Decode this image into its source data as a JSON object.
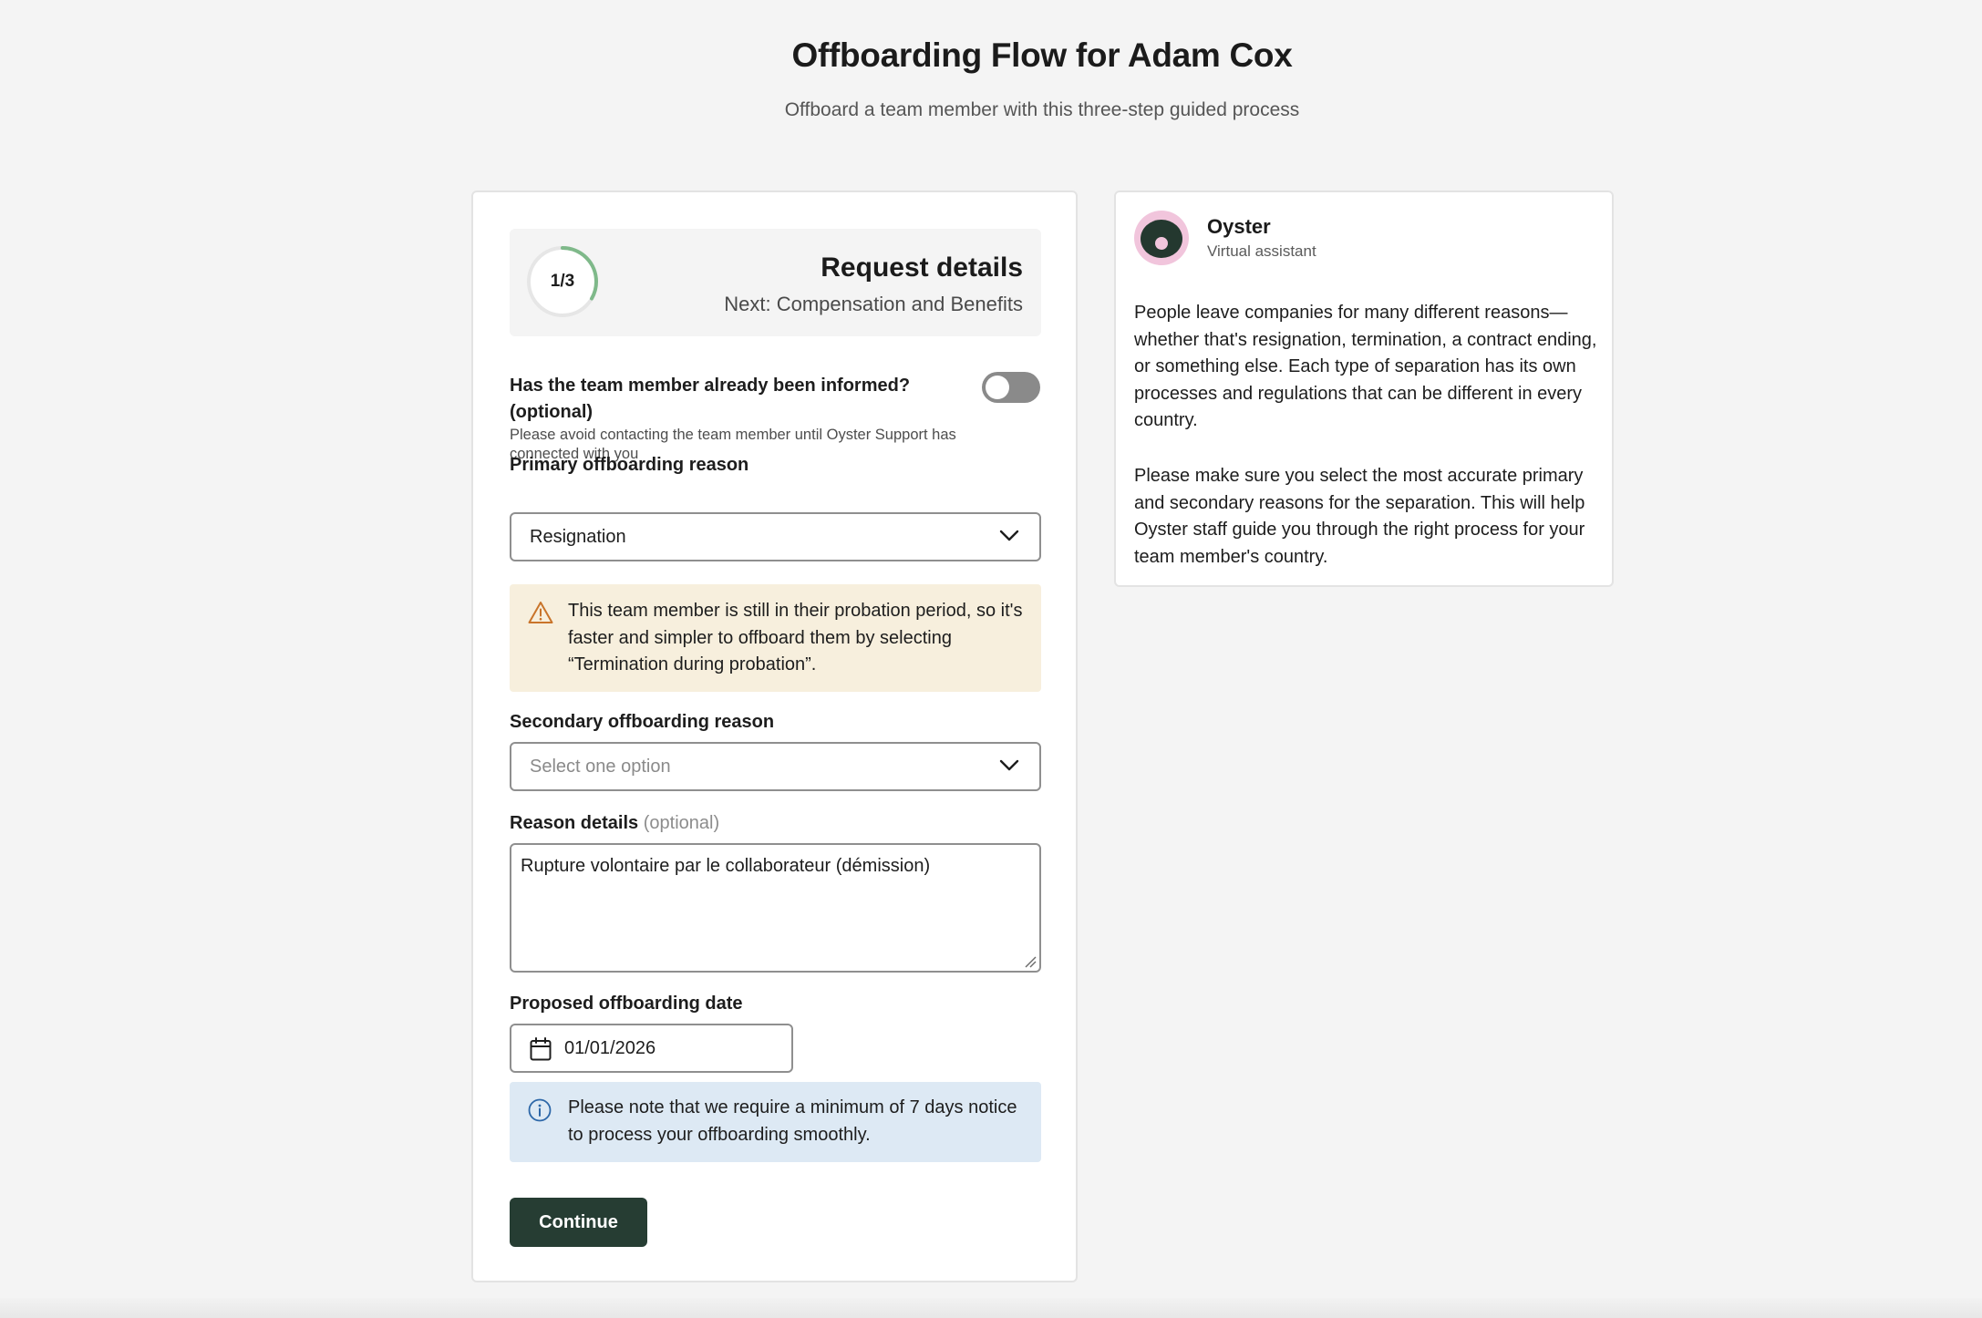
{
  "page": {
    "title": "Offboarding Flow for Adam Cox",
    "subtitle": "Offboard a team member with this three-step guided process"
  },
  "stepper": {
    "step_text": "1/3",
    "progress": 0.333,
    "title": "Request details",
    "next": "Next: Compensation and Benefits",
    "ring_color": "#7fb98a"
  },
  "informed": {
    "question": "Has the team member already been informed? (optional)",
    "hint": "Please avoid contacting the team member until Oyster Support has connected with you",
    "toggle_on": false
  },
  "primary_reason": {
    "label": "Primary offboarding reason",
    "value": "Resignation"
  },
  "warning": {
    "text": "This team member is still in their probation period, so it's faster and simpler to offboard them by selecting “Termination during probation”.",
    "icon": "warning-triangle-icon",
    "color": "#c9742a"
  },
  "secondary_reason": {
    "label": "Secondary offboarding reason",
    "placeholder": "Select one option"
  },
  "reason_details": {
    "label": "Reason details",
    "optional": "(optional)",
    "value": "Rupture volontaire par le collaborateur (démission)"
  },
  "offboarding_date": {
    "label": "Proposed offboarding date",
    "value": "01/01/2026",
    "icon": "calendar-icon"
  },
  "notice": {
    "text": "Please note that we require a minimum of 7 days notice to process your offboarding smoothly.",
    "icon": "info-icon",
    "color": "#2d67a8"
  },
  "actions": {
    "continue_label": "Continue",
    "button_color": "#263d33"
  },
  "assistant": {
    "name": "Oyster",
    "role": "Virtual assistant",
    "message_1": "People leave companies for many different reasons—whether that's resignation, termination, a contract ending, or something else. Each type of separation has its own processes and regulations that can be different in every country.",
    "message_2": "Please make sure you select the most accurate primary and secondary reasons for the separation. This will help Oyster staff guide you through the right process for your team member's country."
  }
}
